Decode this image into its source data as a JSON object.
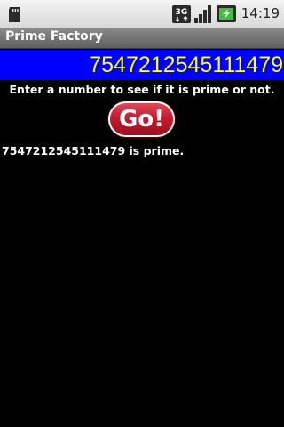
{
  "status_bar": {
    "time": "14:19",
    "network": "3G",
    "icons": [
      "sd-card-icon",
      "3g-icon",
      "signal-icon",
      "battery-charging-icon"
    ]
  },
  "app": {
    "title": "Prime Factory"
  },
  "input": {
    "value": "7547212545111479"
  },
  "instructions": "Enter a number to see if it is prime or not.",
  "go_button": {
    "label": "Go!"
  },
  "result": "7547212545111479 is prime.",
  "colors": {
    "background": "#000000",
    "input_background": "#0000ff",
    "input_text": "#ffff22",
    "button": "#c21d2f",
    "text": "#ffffff"
  }
}
